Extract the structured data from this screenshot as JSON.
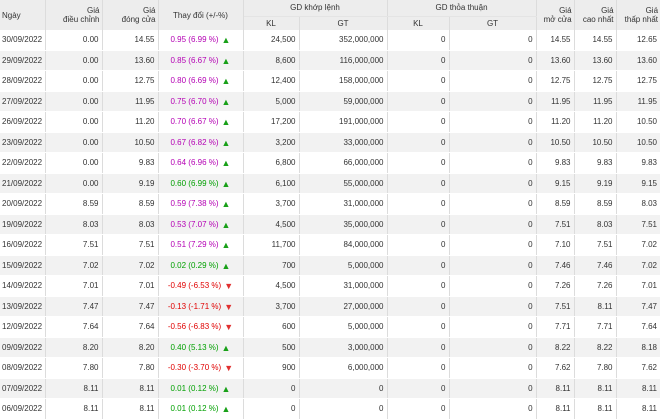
{
  "header": {
    "date": "Ngày",
    "adj_close": "Giá\nđiều chỉnh",
    "close": "Giá\nđóng cửa",
    "change": "Thay đổi (+/-%)",
    "matched": "GD khớp lệnh",
    "negotiated": "GD thỏa thuận",
    "kl": "KL",
    "gt": "GT",
    "open": "Giá\nmở cửa",
    "high": "Giá\ncao nhất",
    "low": "Giá\nthấp nhất"
  },
  "colors": {
    "up": "#b400b4",
    "up_ref": "#00a000",
    "down": "#e00000",
    "header_bg": "#ededed",
    "row_alt_bg": "#f2f2f2"
  },
  "rows": [
    {
      "date": "30/09/2022",
      "adj": "0.00",
      "close": "14.55",
      "chg": "0.95 (6.99 %)",
      "dir": "up",
      "kl": "24,500",
      "gt": "352,000,000",
      "tkl": "0",
      "tgt": "0",
      "open": "14.55",
      "high": "14.55",
      "low": "12.65"
    },
    {
      "date": "29/09/2022",
      "adj": "0.00",
      "close": "13.60",
      "chg": "0.85 (6.67 %)",
      "dir": "up",
      "kl": "8,600",
      "gt": "116,000,000",
      "tkl": "0",
      "tgt": "0",
      "open": "13.60",
      "high": "13.60",
      "low": "13.60"
    },
    {
      "date": "28/09/2022",
      "adj": "0.00",
      "close": "12.75",
      "chg": "0.80 (6.69 %)",
      "dir": "up",
      "kl": "12,400",
      "gt": "158,000,000",
      "tkl": "0",
      "tgt": "0",
      "open": "12.75",
      "high": "12.75",
      "low": "12.75"
    },
    {
      "date": "27/09/2022",
      "adj": "0.00",
      "close": "11.95",
      "chg": "0.75 (6.70 %)",
      "dir": "up",
      "kl": "5,000",
      "gt": "59,000,000",
      "tkl": "0",
      "tgt": "0",
      "open": "11.95",
      "high": "11.95",
      "low": "11.95"
    },
    {
      "date": "26/09/2022",
      "adj": "0.00",
      "close": "11.20",
      "chg": "0.70 (6.67 %)",
      "dir": "up",
      "kl": "17,200",
      "gt": "191,000,000",
      "tkl": "0",
      "tgt": "0",
      "open": "11.20",
      "high": "11.20",
      "low": "10.50"
    },
    {
      "date": "23/09/2022",
      "adj": "0.00",
      "close": "10.50",
      "chg": "0.67 (6.82 %)",
      "dir": "up",
      "kl": "3,200",
      "gt": "33,000,000",
      "tkl": "0",
      "tgt": "0",
      "open": "10.50",
      "high": "10.50",
      "low": "10.50"
    },
    {
      "date": "22/09/2022",
      "adj": "0.00",
      "close": "9.83",
      "chg": "0.64 (6.96 %)",
      "dir": "up",
      "kl": "6,800",
      "gt": "66,000,000",
      "tkl": "0",
      "tgt": "0",
      "open": "9.83",
      "high": "9.83",
      "low": "9.83"
    },
    {
      "date": "21/09/2022",
      "adj": "0.00",
      "close": "9.19",
      "chg": "0.60 (6.99 %)",
      "dir": "upref",
      "kl": "6,100",
      "gt": "55,000,000",
      "tkl": "0",
      "tgt": "0",
      "open": "9.15",
      "high": "9.19",
      "low": "9.15"
    },
    {
      "date": "20/09/2022",
      "adj": "8.59",
      "close": "8.59",
      "chg": "0.59 (7.38 %)",
      "dir": "up",
      "kl": "3,700",
      "gt": "31,000,000",
      "tkl": "0",
      "tgt": "0",
      "open": "8.59",
      "high": "8.59",
      "low": "8.03"
    },
    {
      "date": "19/09/2022",
      "adj": "8.03",
      "close": "8.03",
      "chg": "0.53 (7.07 %)",
      "dir": "up",
      "kl": "4,500",
      "gt": "35,000,000",
      "tkl": "0",
      "tgt": "0",
      "open": "7.51",
      "high": "8.03",
      "low": "7.51"
    },
    {
      "date": "16/09/2022",
      "adj": "7.51",
      "close": "7.51",
      "chg": "0.51 (7.29 %)",
      "dir": "up",
      "kl": "11,700",
      "gt": "84,000,000",
      "tkl": "0",
      "tgt": "0",
      "open": "7.10",
      "high": "7.51",
      "low": "7.02"
    },
    {
      "date": "15/09/2022",
      "adj": "7.02",
      "close": "7.02",
      "chg": "0.02 (0.29 %)",
      "dir": "upref",
      "kl": "700",
      "gt": "5,000,000",
      "tkl": "0",
      "tgt": "0",
      "open": "7.46",
      "high": "7.46",
      "low": "7.02"
    },
    {
      "date": "14/09/2022",
      "adj": "7.01",
      "close": "7.01",
      "chg": "-0.49 (-6.53 %)",
      "dir": "down",
      "kl": "4,500",
      "gt": "31,000,000",
      "tkl": "0",
      "tgt": "0",
      "open": "7.26",
      "high": "7.26",
      "low": "7.01"
    },
    {
      "date": "13/09/2022",
      "adj": "7.47",
      "close": "7.47",
      "chg": "-0.13 (-1.71 %)",
      "dir": "down",
      "kl": "3,700",
      "gt": "27,000,000",
      "tkl": "0",
      "tgt": "0",
      "open": "7.51",
      "high": "8.11",
      "low": "7.47"
    },
    {
      "date": "12/09/2022",
      "adj": "7.64",
      "close": "7.64",
      "chg": "-0.56 (-6.83 %)",
      "dir": "down",
      "kl": "600",
      "gt": "5,000,000",
      "tkl": "0",
      "tgt": "0",
      "open": "7.71",
      "high": "7.71",
      "low": "7.64"
    },
    {
      "date": "09/09/2022",
      "adj": "8.20",
      "close": "8.20",
      "chg": "0.40 (5.13 %)",
      "dir": "upref",
      "kl": "500",
      "gt": "3,000,000",
      "tkl": "0",
      "tgt": "0",
      "open": "8.22",
      "high": "8.22",
      "low": "8.18"
    },
    {
      "date": "08/09/2022",
      "adj": "7.80",
      "close": "7.80",
      "chg": "-0.30 (-3.70 %)",
      "dir": "down",
      "kl": "900",
      "gt": "6,000,000",
      "tkl": "0",
      "tgt": "0",
      "open": "7.62",
      "high": "7.80",
      "low": "7.62"
    },
    {
      "date": "07/09/2022",
      "adj": "8.11",
      "close": "8.11",
      "chg": "0.01 (0.12 %)",
      "dir": "upref",
      "kl": "0",
      "gt": "0",
      "tkl": "0",
      "tgt": "0",
      "open": "8.11",
      "high": "8.11",
      "low": "8.11"
    },
    {
      "date": "06/09/2022",
      "adj": "8.11",
      "close": "8.11",
      "chg": "0.01 (0.12 %)",
      "dir": "upref",
      "kl": "0",
      "gt": "0",
      "tkl": "0",
      "tgt": "0",
      "open": "8.11",
      "high": "8.11",
      "low": "8.11"
    }
  ]
}
